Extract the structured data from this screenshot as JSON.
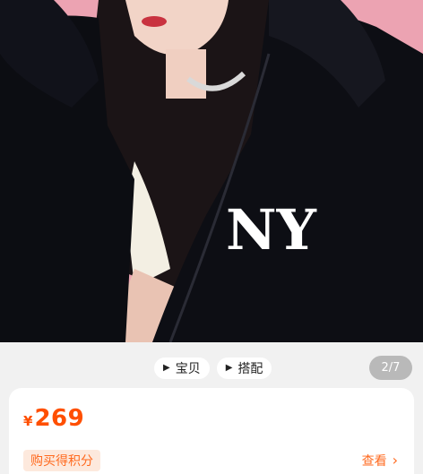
{
  "media_switch": {
    "items": [
      {
        "label": "宝贝",
        "icon": "play-icon"
      },
      {
        "label": "搭配",
        "icon": "play-icon"
      }
    ]
  },
  "gallery": {
    "page_indicator": "2/7",
    "background_color": "#eca3b2"
  },
  "product": {
    "currency": "¥",
    "price": "269",
    "points_tag": "购买得积分",
    "view_label": "查看",
    "accent_color": "#ff4f00"
  }
}
